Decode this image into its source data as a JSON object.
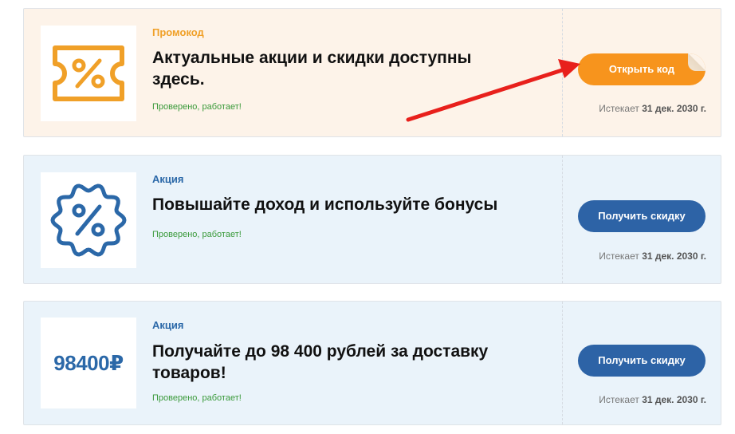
{
  "colors": {
    "promo_accent": "#f7941d",
    "deal_accent": "#2d63a6",
    "verified": "#3a9a3a",
    "arrow": "#e8201c"
  },
  "offers": [
    {
      "type": "Промокод",
      "title": "Актуальные акции и скидки доступны здесь.",
      "verified": "Проверено, работает!",
      "button": "Открыть код",
      "expires_prefix": "Истекает",
      "expires_date": "31 дек. 2030 г.",
      "icon": "ticket-percent-icon"
    },
    {
      "type": "Акция",
      "title": "Повышайте доход и используйте бонусы",
      "verified": "Проверено, работает!",
      "button": "Получить скидку",
      "expires_prefix": "Истекает",
      "expires_date": "31 дек. 2030 г.",
      "icon": "badge-percent-icon"
    },
    {
      "type": "Акция",
      "title": "Получайте до 98 400 рублей за доставку товаров!",
      "verified": "Проверено, работает!",
      "button": "Получить скидку",
      "expires_prefix": "Истекает",
      "expires_date": "31 дек. 2030 г.",
      "amount": "98400₽"
    }
  ]
}
